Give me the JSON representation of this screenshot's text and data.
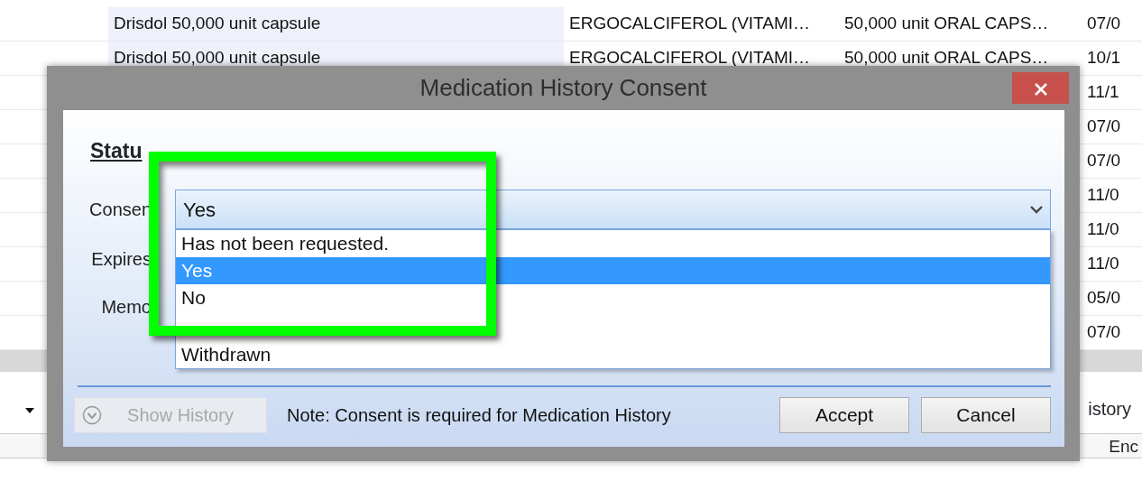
{
  "background_table": {
    "rows": [
      {
        "name": "Drisdol 50,000 unit capsule",
        "ingredient": "ERGOCALCIFEROL (VITAMI…",
        "strength": "50,000 unit ORAL CAPS…",
        "date": "07/0"
      },
      {
        "name": "Drisdol 50,000 unit capsule",
        "ingredient": "ERGOCALCIFEROL (VITAMI…",
        "strength": "50,000 unit ORAL CAPS…",
        "date": "10/1"
      },
      {
        "date": "11/1"
      },
      {
        "date": "07/0"
      },
      {
        "date": "07/0"
      },
      {
        "date": "11/0"
      },
      {
        "date": "11/0"
      },
      {
        "date": "11/0"
      },
      {
        "date": "05/0"
      },
      {
        "date": "07/0"
      }
    ]
  },
  "toolbar": {
    "right_text": "istory"
  },
  "header": {
    "column": "Enc"
  },
  "dialog": {
    "title": "Medication History Consent",
    "status_label": "Statu",
    "fields": [
      {
        "label": "Consen"
      },
      {
        "label": "Expires"
      },
      {
        "label": "Memo"
      }
    ],
    "consent_value": "Yes",
    "options": [
      {
        "label": "Has not been requested.",
        "selected": false
      },
      {
        "label": "Yes",
        "selected": true
      },
      {
        "label": "No",
        "selected": false
      },
      {
        "label": "Withdrawn",
        "selected": false
      }
    ],
    "show_history": {
      "label": "Show History",
      "disabled": true
    },
    "note": "Note: Consent is required for Medication History",
    "buttons": [
      "Accept",
      "Cancel"
    ]
  }
}
